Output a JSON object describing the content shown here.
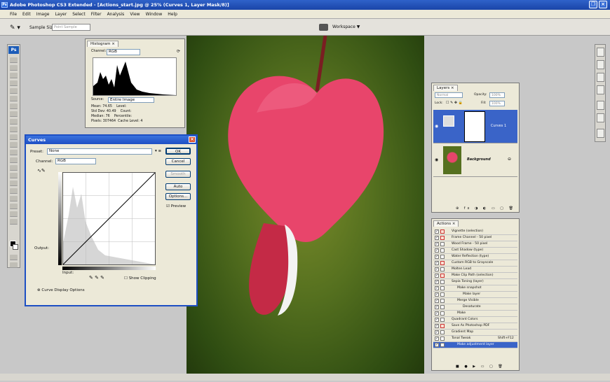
{
  "app": {
    "title": "Adobe Photoshop CS3 Extended - [Actions_start.jpg @ 25% (Curves 1, Layer Mask/8)]",
    "icon": "Ps"
  },
  "menu": [
    "File",
    "Edit",
    "Image",
    "Layer",
    "Select",
    "Filter",
    "Analysis",
    "View",
    "Window",
    "Help"
  ],
  "options_bar": {
    "sample_size_label": "Sample Size:",
    "sample_size_value": "Point Sample",
    "workspace_label": "Workspace ▼"
  },
  "histogram": {
    "tab": "Histogram ×",
    "channel_label": "Channel:",
    "channel_value": "RGB",
    "source_label": "Source:",
    "source_value": "Entire Image",
    "stats": [
      {
        "k": "Mean:",
        "v": "74.65",
        "k2": "Level:",
        "v2": ""
      },
      {
        "k": "Std Dev:",
        "v": "40.49",
        "k2": "Count:",
        "v2": ""
      },
      {
        "k": "Median:",
        "v": "76",
        "k2": "Percentile:",
        "v2": ""
      },
      {
        "k": "Pixels:",
        "v": "307464",
        "k2": "Cache Level:",
        "v2": "4"
      }
    ]
  },
  "curves": {
    "title": "Curves",
    "preset_label": "Preset:",
    "preset_value": "None",
    "channel_label": "Channel:",
    "channel_value": "RGB",
    "ok": "OK",
    "cancel": "Cancel",
    "smooth": "Smooth",
    "auto": "Auto",
    "options": "Options...",
    "preview": "Preview",
    "output_label": "Output:",
    "input_label": "Input:",
    "show_clipping": "Show Clipping",
    "display_options": "Curve Display Options"
  },
  "layers": {
    "tab": "Layers ×",
    "mode_value": "Normal",
    "opacity_label": "Opacity:",
    "opacity_value": "100%",
    "lock_label": "Lock:",
    "fill_label": "Fill:",
    "fill_value": "100%",
    "items": [
      {
        "name": "Curves 1",
        "selected": true
      },
      {
        "name": "Background",
        "selected": false
      }
    ]
  },
  "actions": {
    "tab": "Actions ×",
    "items": [
      {
        "label": "Vignette (selection)",
        "indent": 1,
        "dialog": true
      },
      {
        "label": "Frame Channel - 50 pixel",
        "indent": 1,
        "dialog": true
      },
      {
        "label": "Wood Frame - 50 pixel",
        "indent": 1,
        "dialog": false
      },
      {
        "label": "Cast Shadow (type)",
        "indent": 1,
        "dialog": false
      },
      {
        "label": "Water Reflection (type)",
        "indent": 1,
        "dialog": false
      },
      {
        "label": "Custom RGB to Grayscale",
        "indent": 1,
        "dialog": true
      },
      {
        "label": "Molten Lead",
        "indent": 1,
        "dialog": false
      },
      {
        "label": "Make Clip Path (selection)",
        "indent": 1,
        "dialog": true
      },
      {
        "label": "Sepia Toning (layer)",
        "indent": 1,
        "dialog": false
      },
      {
        "label": "Make snapshot",
        "indent": 2,
        "dialog": false
      },
      {
        "label": "Make layer",
        "indent": 3,
        "dialog": false
      },
      {
        "label": "Merge Visible",
        "indent": 2,
        "dialog": false
      },
      {
        "label": "Desaturate",
        "indent": 3,
        "dialog": false
      },
      {
        "label": "Make",
        "indent": 2,
        "dialog": false
      },
      {
        "label": "Quadrant Colors",
        "indent": 1,
        "dialog": false
      },
      {
        "label": "Save As Photoshop PDF",
        "indent": 1,
        "dialog": true
      },
      {
        "label": "Gradient Map",
        "indent": 1,
        "dialog": false
      },
      {
        "label": "Tonal Tweak",
        "indent": 1,
        "dialog": false,
        "shortcut": "Shift+F12"
      },
      {
        "label": "Make adjustment layer",
        "indent": 2,
        "dialog": false,
        "selected": true
      }
    ]
  },
  "colors": {
    "title_blue": "#1d4fc4",
    "selection_blue": "#3a64c8",
    "flower_pink": "#e8456b",
    "background_green": "#55701f"
  }
}
